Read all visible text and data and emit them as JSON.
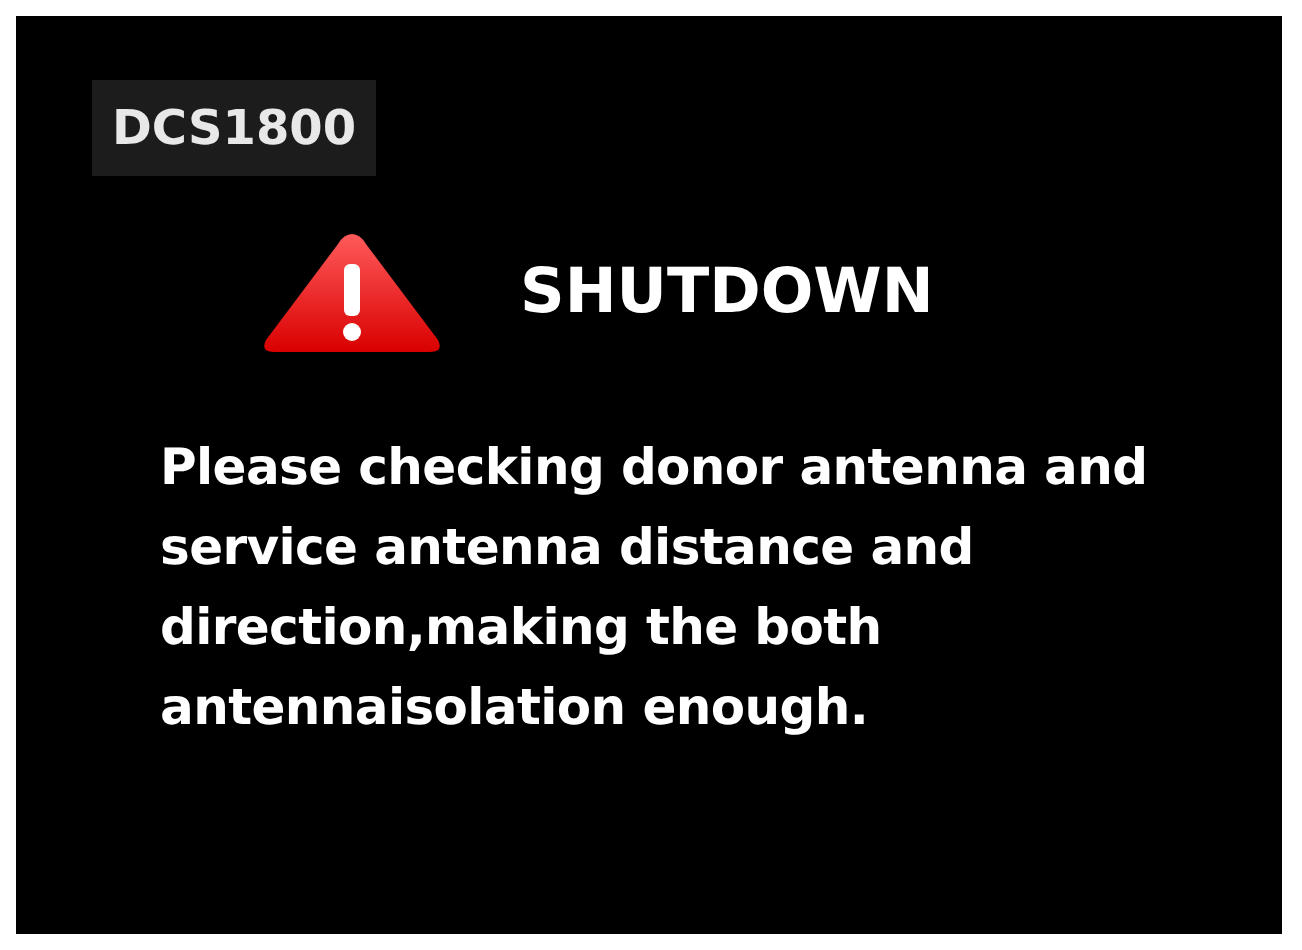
{
  "band_label": "DCS1800",
  "alert": {
    "title": "SHUTDOWN",
    "message": "Please checking donor antenna and service antenna distance and direction,making the both antennaisolation enough."
  }
}
